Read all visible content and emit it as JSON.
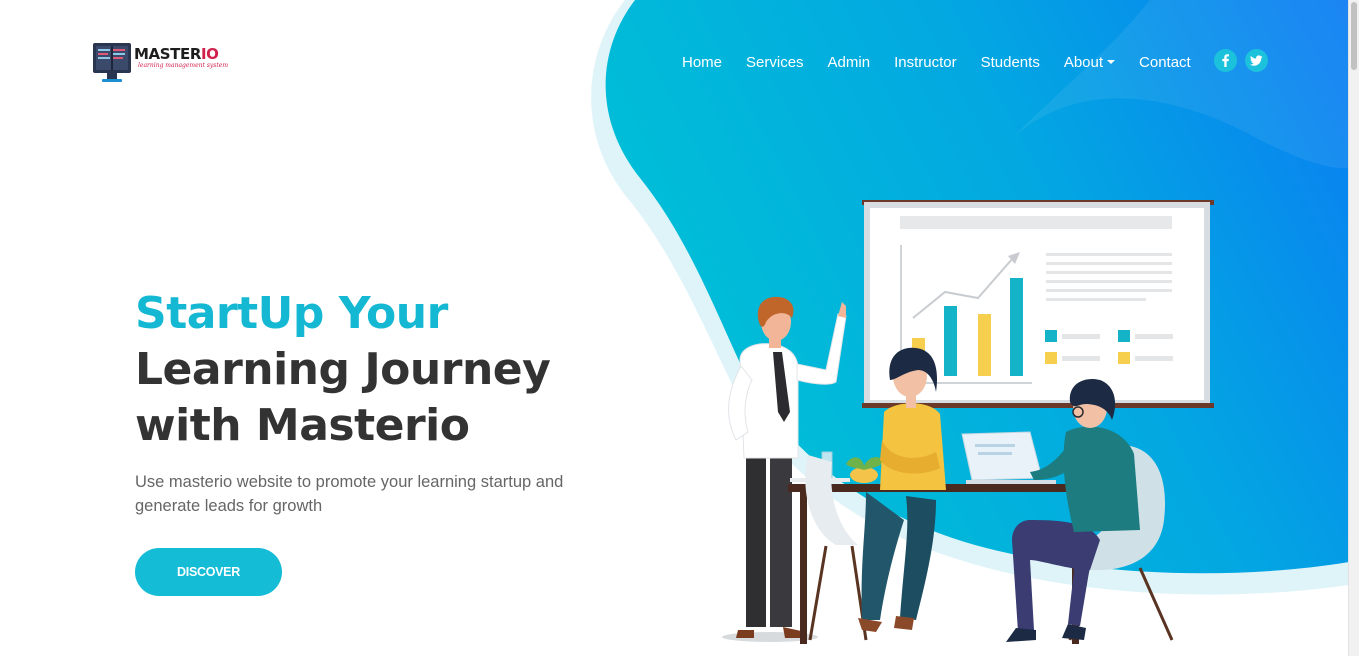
{
  "brand": {
    "name_prefix": "MASTER",
    "name_suffix": "IO",
    "tagline": "learning management system"
  },
  "nav": {
    "items": [
      {
        "label": "Home",
        "active": true
      },
      {
        "label": "Services"
      },
      {
        "label": "Admin"
      },
      {
        "label": "Instructor"
      },
      {
        "label": "Students"
      },
      {
        "label": "About",
        "dropdown": true
      },
      {
        "label": "Contact"
      }
    ],
    "social": [
      {
        "icon": "facebook-icon"
      },
      {
        "icon": "twitter-icon"
      }
    ]
  },
  "hero": {
    "headline_accent": "StartUp Your",
    "headline_line2": "Learning Journey",
    "headline_line3": "with Masterio",
    "subtext": "Use masterio website to promote your learning startup and generate leads for growth",
    "cta_label": "DISCOVER"
  },
  "colors": {
    "accent": "#14b8d2",
    "hero_gradient_start": "#00bcd4",
    "hero_gradient_end": "#0a7cf3",
    "heading_text": "#333333",
    "body_text": "#666666",
    "brand_red": "#d1214b"
  }
}
